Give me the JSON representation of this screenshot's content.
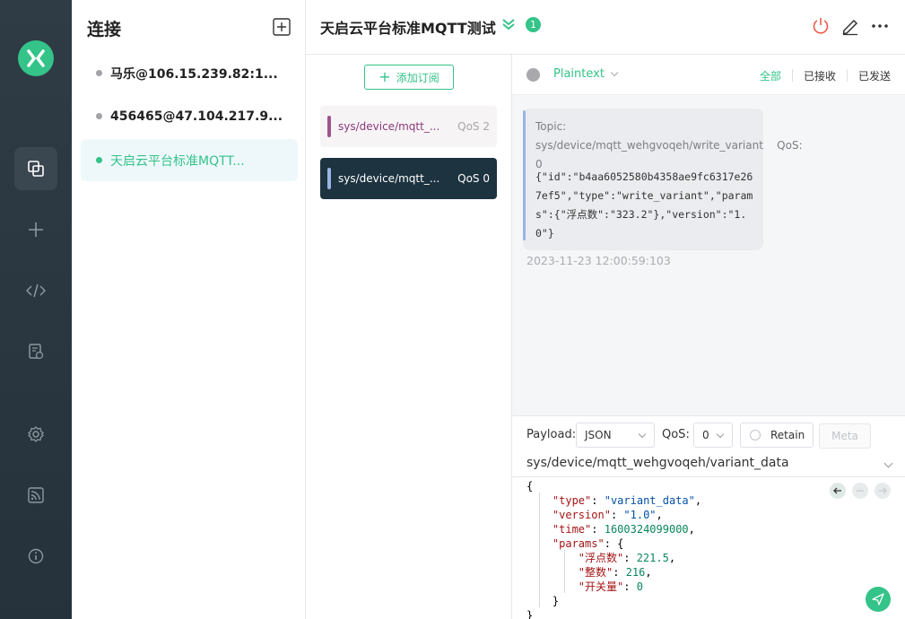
{
  "connections_panel": {
    "title": "连接",
    "items": [
      {
        "label": "马乐@106.15.239.82:1...",
        "status": "disconnected"
      },
      {
        "label": "456465@47.104.217.9...",
        "status": "disconnected"
      },
      {
        "label": "天启云平台标准MQTT...",
        "status": "connected",
        "active": true
      }
    ]
  },
  "header": {
    "title": "天启云平台标准MQTT测试",
    "badge_count": "1"
  },
  "subscriptions": {
    "add_label": "添加订阅",
    "items": [
      {
        "topic": "sys/device/mqtt_...",
        "qos": "QoS 2",
        "color": "#a0538e"
      },
      {
        "topic": "sys/device/mqtt_...",
        "qos": "QoS 0",
        "color": "#9ab4e6"
      }
    ]
  },
  "messages": {
    "format": "Plaintext",
    "filters": [
      "全部",
      "已接收",
      "已发送"
    ],
    "items": [
      {
        "topic_line": "Topic: sys/device/mqtt_wehgvoqeh/write_variant",
        "qos_line": "QoS: 0",
        "payload": "{\"id\":\"b4aa6052580b4358ae9fc6317e267ef5\",\"type\":\"write_variant\",\"params\":{\"浮点数\":\"323.2\"},\"version\":\"1.0\"}",
        "time": "2023-11-23 12:00:59:103"
      }
    ]
  },
  "publish": {
    "payload_label": "Payload:",
    "payload_format": "JSON",
    "qos_label": "QoS:",
    "qos_value": "0",
    "retain_label": "Retain",
    "meta_label": "Meta",
    "topic": "sys/device/mqtt_wehgvoqeh/variant_data",
    "json_lines": [
      "{",
      "    \"type\": \"variant_data\",",
      "    \"version\": \"1.0\",",
      "    \"time\": 1600324099000,",
      "    \"params\": {",
      "        \"浮点数\": 221.5,",
      "        \"整数\": 216,",
      "        \"开关量\": 0",
      "    }",
      "}"
    ]
  },
  "colors": {
    "accent": "#34c388",
    "rail": "#2f3b45",
    "selected_sub": "#1d3340"
  },
  "icons": {
    "rail": [
      "connections-icon",
      "plus-icon",
      "script-icon",
      "log-icon",
      "settings-icon",
      "feed-icon",
      "info-icon"
    ],
    "header": [
      "power-icon",
      "edit-icon",
      "more-icon"
    ]
  }
}
